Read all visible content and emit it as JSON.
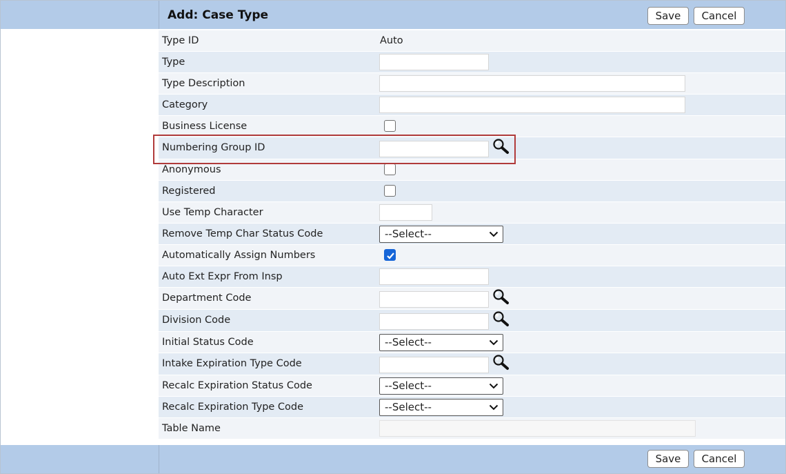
{
  "header": {
    "title": "Add: Case Type",
    "save_label": "Save",
    "cancel_label": "Cancel"
  },
  "footer": {
    "save_label": "Save",
    "cancel_label": "Cancel"
  },
  "fields": {
    "type_id": {
      "label": "Type ID",
      "value": "Auto"
    },
    "type": {
      "label": "Type",
      "value": ""
    },
    "type_description": {
      "label": "Type Description",
      "value": ""
    },
    "category": {
      "label": "Category",
      "value": ""
    },
    "business_license": {
      "label": "Business License",
      "checked": false
    },
    "numbering_group_id": {
      "label": "Numbering Group ID",
      "value": ""
    },
    "anonymous": {
      "label": "Anonymous",
      "checked": false
    },
    "registered": {
      "label": "Registered",
      "checked": false
    },
    "use_temp_character": {
      "label": "Use Temp Character",
      "value": ""
    },
    "remove_temp_char_status_code": {
      "label": "Remove Temp Char Status Code",
      "selected": "--Select--"
    },
    "auto_assign_numbers": {
      "label": "Automatically Assign Numbers",
      "checked": true
    },
    "auto_ext_expr_from_insp": {
      "label": "Auto Ext Expr From Insp",
      "value": ""
    },
    "department_code": {
      "label": "Department Code",
      "value": ""
    },
    "division_code": {
      "label": "Division Code",
      "value": ""
    },
    "initial_status_code": {
      "label": "Initial Status Code",
      "selected": "--Select--"
    },
    "intake_expiration_type_code": {
      "label": "Intake Expiration Type Code",
      "value": ""
    },
    "recalc_expiration_status_code": {
      "label": "Recalc Expiration Status Code",
      "selected": "--Select--"
    },
    "recalc_expiration_type_code": {
      "label": "Recalc Expiration Type Code",
      "selected": "--Select--"
    },
    "table_name": {
      "label": "Table Name",
      "value": ""
    }
  },
  "icons": {
    "lookup": "magnifier-icon",
    "checkmark": "checkmark-icon",
    "dropdown": "chevron-down-icon"
  },
  "colors": {
    "header_bar": "#b3cbe8",
    "row_light": "#f1f4f8",
    "row_dark": "#e3ebf4",
    "checkbox_on": "#1565d8",
    "highlight": "#b03a3a"
  }
}
